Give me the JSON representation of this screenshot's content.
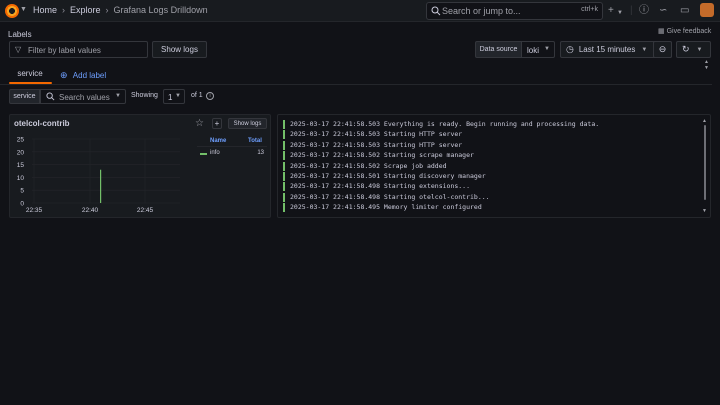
{
  "topbar": {
    "breadcrumbs": [
      "Home",
      "Explore",
      "Grafana Logs Drilldown"
    ],
    "search_placeholder": "Search or jump to...",
    "search_shortcut": "ctrl+k",
    "plus_label": "+"
  },
  "labels_section": {
    "title": "Labels",
    "filter_placeholder": "Filter by label values",
    "show_logs_label": "Show logs",
    "give_feedback_label": "Give feedback",
    "data_source_label": "Data source",
    "data_source_value": "loki",
    "time_range_label": "Last 15 minutes"
  },
  "tabs": {
    "active_tab": "service",
    "add_label": "Add label"
  },
  "service_filter": {
    "label": "service",
    "search_placeholder": "Search values",
    "showing_label": "Showing",
    "page_value": "1",
    "of_pages": "of 1"
  },
  "panel": {
    "title": "otelcol-contrib",
    "show_logs_label": "Show logs",
    "legend": {
      "name_header": "Name",
      "total_header": "Total",
      "items": [
        {
          "name": "info",
          "total": "13",
          "color": "#73bf69"
        }
      ]
    }
  },
  "chart_data": {
    "type": "bar",
    "title": "otelcol-contrib",
    "x_tick_labels": [
      "22:35",
      "22:40",
      "22:45"
    ],
    "y_tick_labels": [
      "25",
      "20",
      "15",
      "10",
      "5",
      "0"
    ],
    "ylim": [
      0,
      25
    ],
    "series": [
      {
        "name": "info",
        "color": "#73bf69",
        "points": [
          {
            "x": "22:41",
            "y": 13
          }
        ]
      }
    ],
    "legend": "right",
    "grid": true
  },
  "logs": {
    "lines": [
      "2025-03-17 22:41:58.503 Everything is ready. Begin running and processing data.",
      "2025-03-17 22:41:58.503 Starting HTTP server",
      "2025-03-17 22:41:58.503 Starting HTTP server",
      "2025-03-17 22:41:58.502 Starting scrape manager",
      "2025-03-17 22:41:58.502 Scrape job added",
      "2025-03-17 22:41:58.501 Starting discovery manager",
      "2025-03-17 22:41:58.498 Starting extensions...",
      "2025-03-17 22:41:58.498 Starting otelcol-contrib...",
      "2025-03-17 22:41:58.495 Memory limiter configured"
    ],
    "level_color": "#73bf69"
  },
  "colors": {
    "background": "#111217",
    "panel": "#181b1f",
    "accent": "#f46800",
    "link": "#6e9fff",
    "border": "#34363c"
  }
}
